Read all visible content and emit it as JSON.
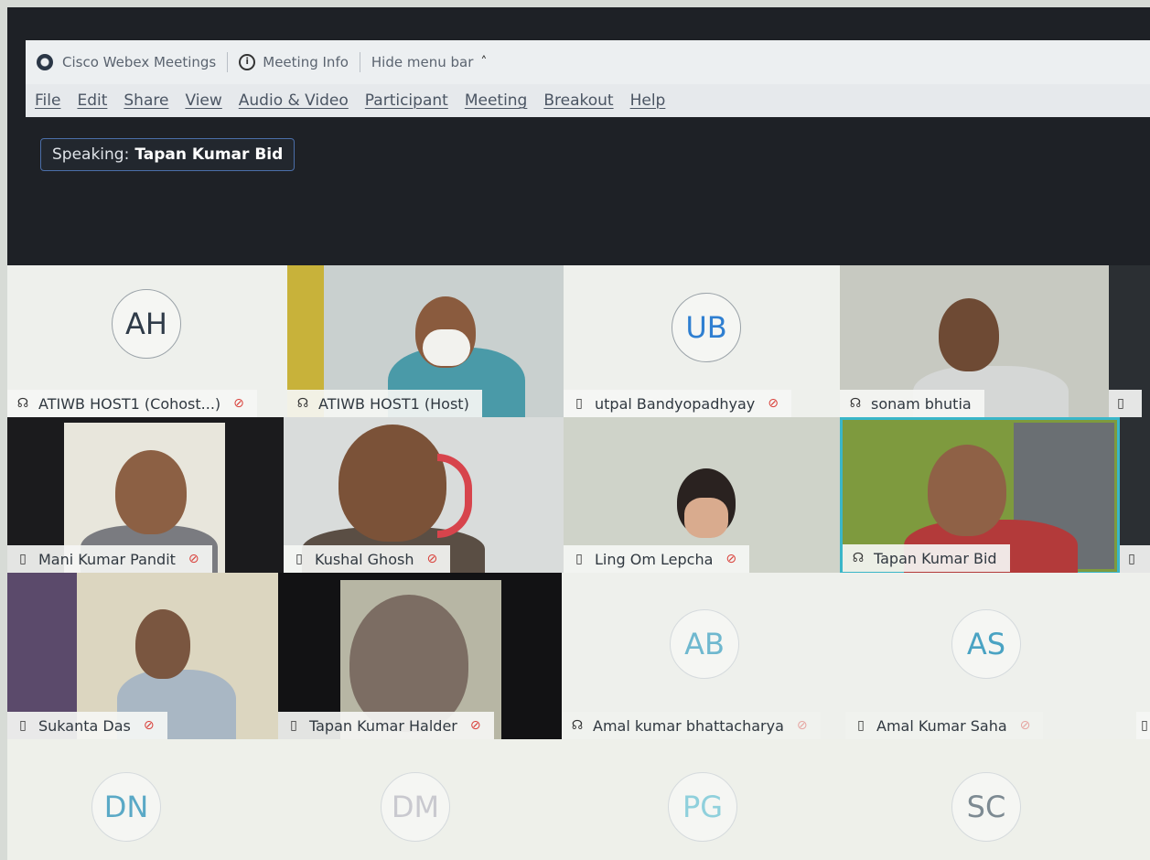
{
  "titlebar": {
    "app_name": "Cisco Webex Meetings",
    "meeting_info": "Meeting Info",
    "hide_menu_bar": "Hide menu bar"
  },
  "menubar": {
    "items": [
      "File",
      "Edit",
      "Share",
      "View",
      "Audio & Video",
      "Participant",
      "Meeting",
      "Breakout",
      "Help"
    ]
  },
  "speaking": {
    "label": "Speaking:",
    "name": "Tapan Kumar Bid"
  },
  "participants": [
    {
      "initials": "AH",
      "name": "ATIWB HOST1 (Cohost...)",
      "device": "headset-icon",
      "muted": true,
      "video": false
    },
    {
      "name": "ATIWB HOST1 (Host)",
      "device": "headset-icon",
      "muted": false,
      "video": true
    },
    {
      "initials": "UB",
      "name": "utpal Bandyopadhyay",
      "device": "phone-icon",
      "muted": true,
      "video": false
    },
    {
      "name": "sonam bhutia",
      "device": "headset-icon",
      "muted": false,
      "video": true
    },
    {
      "name": "Mani Kumar Pandit",
      "device": "phone-icon",
      "muted": true,
      "video": true
    },
    {
      "name": "Kushal Ghosh",
      "device": "phone-icon",
      "muted": true,
      "video": true
    },
    {
      "name": "Ling Om Lepcha",
      "device": "phone-icon",
      "muted": true,
      "video": true
    },
    {
      "name": "Tapan Kumar Bid",
      "device": "headset-icon",
      "muted": false,
      "video": true,
      "active_speaker": true
    },
    {
      "name": "Sukanta Das",
      "device": "phone-icon",
      "muted": true,
      "video": true
    },
    {
      "name": "Tapan Kumar Halder",
      "device": "phone-icon",
      "muted": true,
      "video": true
    },
    {
      "initials": "AB",
      "name": "Amal kumar bhattacharya",
      "device": "headset-icon",
      "muted": true,
      "video": false
    },
    {
      "initials": "AS",
      "name": "Amal Kumar Saha",
      "device": "phone-icon",
      "muted": true,
      "video": false
    },
    {
      "initials": "DN",
      "video": false
    },
    {
      "initials": "DM",
      "video": false
    },
    {
      "initials": "PG",
      "video": false
    },
    {
      "initials": "SC",
      "video": false
    }
  ],
  "colors": {
    "accent_blue": "#2f7fd1",
    "active_speaker_border": "#3ab6c8",
    "muted_red": "#d9413b"
  }
}
